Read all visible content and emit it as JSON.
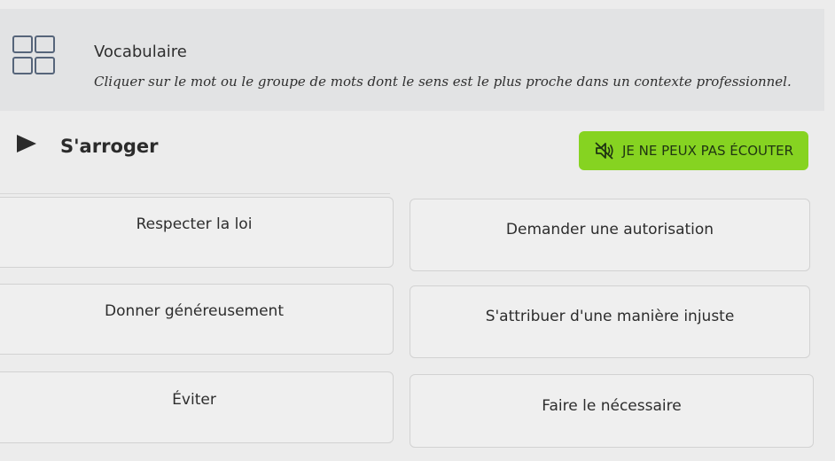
{
  "header": {
    "title": "Vocabulaire",
    "icon": "grid-icon",
    "instruction": "Cliquer sur le mot ou le groupe de mots dont le sens est le plus proche dans un contexte professionnel."
  },
  "question": {
    "word": "S'arroger",
    "play_icon": "play-icon"
  },
  "cant_listen": {
    "label": "JE NE PEUX PAS ÉCOUTER",
    "icon": "speaker-muted-icon",
    "color": "#86d321"
  },
  "options": [
    {
      "label": "Respecter la loi"
    },
    {
      "label": "Demander une autorisation"
    },
    {
      "label": "Donner généreusement"
    },
    {
      "label": "S'attribuer d'une manière injuste"
    },
    {
      "label": "Éviter"
    },
    {
      "label": "Faire le nécessaire"
    }
  ]
}
